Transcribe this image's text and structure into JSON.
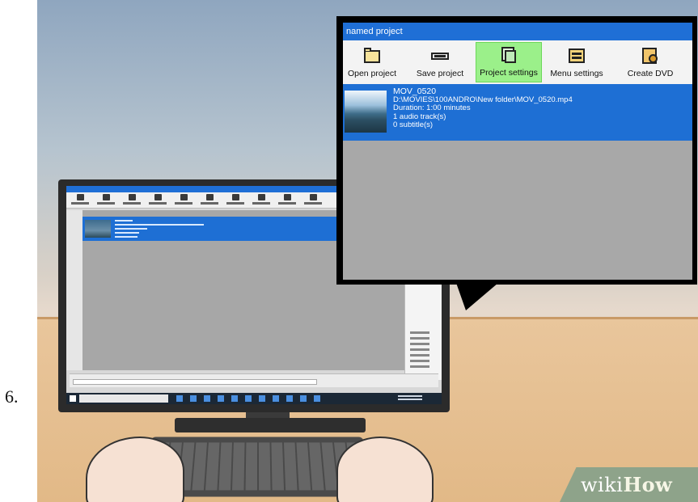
{
  "step": {
    "number": "6."
  },
  "zoom": {
    "window_title": "named project",
    "toolbar": [
      {
        "label": "Open project",
        "icon": "folder-icon"
      },
      {
        "label": "Save project",
        "icon": "drive-icon"
      },
      {
        "label": "Project settings",
        "icon": "settings-icon",
        "active": true
      },
      {
        "label": "Menu settings",
        "icon": "menu-icon"
      },
      {
        "label": "Create DVD",
        "icon": "dvd-icon"
      }
    ],
    "item": {
      "name": "MOV_0520",
      "path": "D:\\MOVIES\\100ANDRO\\New folder\\MOV_0520.mp4",
      "duration": "Duration: 1:00 minutes",
      "audio": "1 audio track(s)",
      "subtitles": "0 subtitle(s)"
    }
  },
  "watermark": {
    "brand_a": "wiki",
    "brand_b": "How"
  },
  "colors": {
    "title_bar": "#1f6fd6",
    "selected_row": "#1e6fd4",
    "active_button": "#9bf08a"
  }
}
